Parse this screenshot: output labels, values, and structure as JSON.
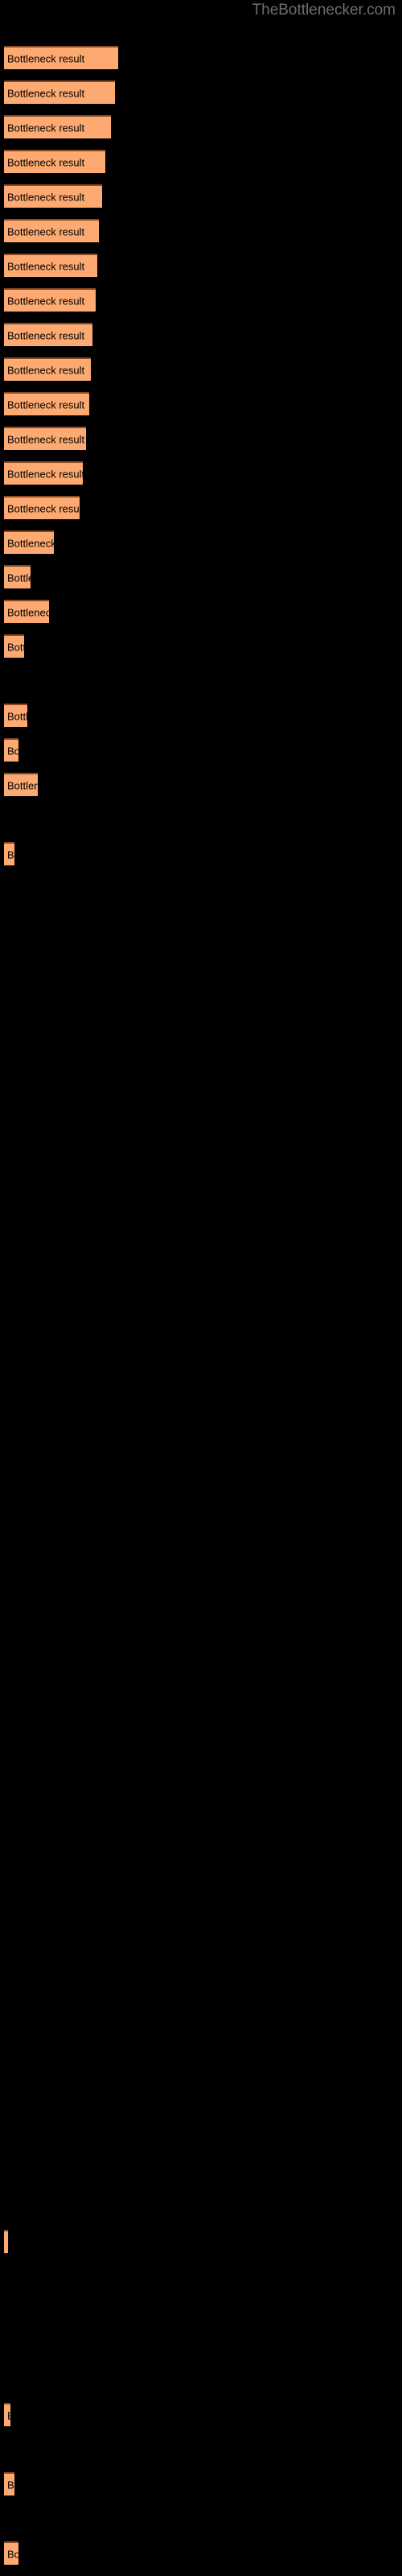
{
  "watermark": "TheBottlenecker.com",
  "colors": {
    "background": "#000000",
    "bar_fill": "#fcaa71",
    "bar_top_edge": "#8a4a22",
    "bar_label_text": "#000000",
    "watermark_text": "#6e6e6e"
  },
  "bar_label": "Bottleneck result",
  "chart_data": {
    "type": "bar",
    "orientation": "horizontal",
    "title": "",
    "subtitle": "TheBottlenecker.com",
    "xlabel": "",
    "ylabel": "",
    "grid": false,
    "legend": null,
    "axis_visible": false,
    "tick_labels": [],
    "xlim": [
      0,
      145
    ],
    "categories": [
      "Bottleneck result",
      "Bottleneck result",
      "Bottleneck result",
      "Bottleneck result",
      "Bottleneck result",
      "Bottleneck result",
      "Bottleneck result",
      "Bottleneck result",
      "Bottleneck result",
      "Bottleneck result",
      "Bottleneck result",
      "Bottleneck result",
      "Bottleneck result",
      "Bottleneck result",
      "Bottleneck result",
      "Bottleneck result",
      "Bottleneck result",
      "Bottleneck result",
      "Bottleneck result",
      "Bottleneck result",
      "Bottleneck result",
      "Bottleneck result",
      "Bottleneck result",
      "Bottleneck result",
      "Bottleneck result",
      "Bottleneck result",
      "Bottleneck result",
      "Bottleneck result"
    ],
    "values": [
      71,
      69,
      66,
      62,
      60,
      58,
      57,
      56,
      54,
      53,
      52,
      50,
      48,
      46,
      30,
      16,
      27,
      12,
      14,
      9,
      20,
      6,
      2,
      1,
      2,
      4,
      7,
      10
    ],
    "bars": [
      {
        "index": 0,
        "label": "Bottleneck result",
        "value": 71,
        "y": 57,
        "height": 29,
        "width": 142
      },
      {
        "index": 1,
        "label": "Bottleneck result",
        "value": 69,
        "y": 100,
        "height": 29,
        "width": 138
      },
      {
        "index": 2,
        "label": "Bottleneck result",
        "value": 66,
        "y": 143,
        "height": 29,
        "width": 133
      },
      {
        "index": 3,
        "label": "Bottleneck result",
        "value": 62,
        "y": 186,
        "height": 29,
        "width": 126
      },
      {
        "index": 4,
        "label": "Bottleneck result",
        "value": 60,
        "y": 229,
        "height": 29,
        "width": 122
      },
      {
        "index": 5,
        "label": "Bottleneck result",
        "value": 58,
        "y": 272,
        "height": 29,
        "width": 118
      },
      {
        "index": 6,
        "label": "Bottleneck result",
        "value": 57,
        "y": 315,
        "height": 29,
        "width": 116
      },
      {
        "index": 7,
        "label": "Bottleneck result",
        "value": 56,
        "y": 358,
        "height": 29,
        "width": 114
      },
      {
        "index": 8,
        "label": "Bottleneck result",
        "value": 54,
        "y": 401,
        "height": 29,
        "width": 110
      },
      {
        "index": 9,
        "label": "Bottleneck result",
        "value": 53,
        "y": 444,
        "height": 29,
        "width": 108
      },
      {
        "index": 10,
        "label": "Bottleneck result",
        "value": 52,
        "y": 487,
        "height": 29,
        "width": 106
      },
      {
        "index": 11,
        "label": "Bottleneck result",
        "value": 50,
        "y": 530,
        "height": 29,
        "width": 102
      },
      {
        "index": 12,
        "label": "Bottleneck result",
        "value": 48,
        "y": 573,
        "height": 29,
        "width": 98
      },
      {
        "index": 13,
        "label": "Bottleneck result",
        "value": 46,
        "y": 616,
        "height": 29,
        "width": 94
      },
      {
        "index": 14,
        "label": "Bottleneck result",
        "value": 30,
        "y": 659,
        "height": 29,
        "width": 62
      },
      {
        "index": 15,
        "label": "Bottleneck result",
        "value": 16,
        "y": 702,
        "height": 29,
        "width": 33
      },
      {
        "index": 16,
        "label": "Bottleneck result",
        "value": 27,
        "y": 745,
        "height": 29,
        "width": 56
      },
      {
        "index": 17,
        "label": "Bottleneck result",
        "value": 12,
        "y": 788,
        "height": 29,
        "width": 25
      },
      {
        "index": 18,
        "label": "Bottleneck result",
        "value": 14,
        "y": 874,
        "height": 29,
        "width": 29
      },
      {
        "index": 19,
        "label": "Bottleneck result",
        "value": 9,
        "y": 917,
        "height": 29,
        "width": 18
      },
      {
        "index": 20,
        "label": "Bottleneck result",
        "value": 20,
        "y": 960,
        "height": 29,
        "width": 42
      },
      {
        "index": 21,
        "label": "Bottleneck result",
        "value": 6,
        "y": 1046,
        "height": 29,
        "width": 13
      },
      {
        "index": 22,
        "label": "Bottleneck result",
        "value": 2,
        "y": 2770,
        "height": 29,
        "width": 5
      },
      {
        "index": 23,
        "label": "Bottleneck result",
        "value": 1,
        "y": 2985,
        "height": 29,
        "width": 8
      },
      {
        "index": 24,
        "label": "Bottleneck result",
        "value": 2,
        "y": 3071,
        "height": 29,
        "width": 13
      },
      {
        "index": 25,
        "label": "Bottleneck result",
        "value": 4,
        "y": 3157,
        "height": 29,
        "width": 18
      }
    ]
  }
}
